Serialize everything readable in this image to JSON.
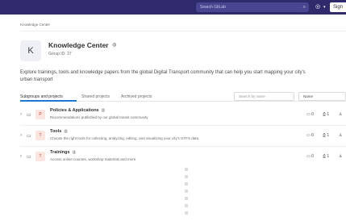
{
  "topbar": {
    "search_placeholder": "Search GitLab",
    "search_icon": "search-icon",
    "help_icon": "help-icon",
    "help_caret": "▾",
    "signin_label": "Sign"
  },
  "breadcrumb": "Knowledge Center",
  "group": {
    "avatar_letter": "K",
    "title": "Knowledge Center",
    "visibility_icon": "globe-icon",
    "group_id": "Group ID: 37",
    "description_line1": "Explore trainings, tools and knowledge papers from the global Digital Transport community that can help you start mapping your city's",
    "description_line2": "urban transport"
  },
  "tabs": [
    {
      "label": "Subgroups and projects",
      "active": true
    },
    {
      "label": "Shared projects",
      "active": false
    },
    {
      "label": "Archived projects",
      "active": false
    }
  ],
  "filter_placeholder": "Search by name",
  "sort_label": "Name",
  "rows": [
    {
      "chevron": "›",
      "folder_icon": "folder-icon",
      "avatar_letter": "P",
      "title": "Policies & Applications",
      "globe": "◍",
      "description": "Recommendations published by our global transit community",
      "subgroups": "0",
      "projects": "1",
      "members": "♙"
    },
    {
      "chevron": "›",
      "folder_icon": "folder-icon",
      "avatar_letter": "T",
      "title": "Tools",
      "globe": "◍",
      "description": "Choose the right tools for collecting, analyzing, editing, and visualizing your city's GTFS data",
      "subgroups": "0",
      "projects": "1",
      "members": "♙"
    },
    {
      "chevron": "›",
      "folder_icon": "folder-icon",
      "avatar_letter": "T",
      "title": "Trainings",
      "globe": "◍",
      "description": "Access online courses, workshop materials and more",
      "subgroups": "0",
      "projects": "1",
      "members": "♙"
    }
  ]
}
